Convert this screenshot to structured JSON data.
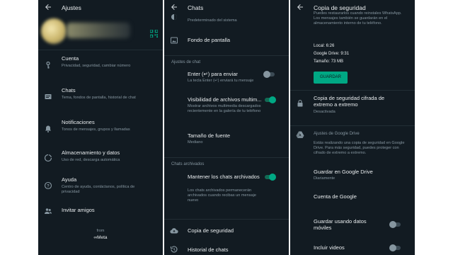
{
  "screen1": {
    "title": "Ajustes",
    "items": [
      {
        "label": "Cuenta",
        "sub": "Privacidad, seguridad, cambiar número",
        "icon": "key-icon"
      },
      {
        "label": "Chats",
        "sub": "Tema, fondos de pantalla, historial de chat",
        "icon": "chat-icon"
      },
      {
        "label": "Notificaciones",
        "sub": "Tonos de mensajes, grupos y llamadas",
        "icon": "bell-icon"
      },
      {
        "label": "Almacenamiento y datos",
        "sub": "Uso de red, descarga automática",
        "icon": "data-usage-icon"
      },
      {
        "label": "Ayuda",
        "sub": "Centro de ayuda, contáctanos, política de privacidad",
        "icon": "help-icon"
      },
      {
        "label": "Invitar amigos",
        "sub": "",
        "icon": "people-icon"
      }
    ],
    "footer_from": "from",
    "footer_brand": "∞Meta"
  },
  "screen2": {
    "title": "Chats",
    "top_partial_text": "Predeterminado del sistema",
    "wallpaper": "Fondo de pantalla",
    "section_chat": "Ajustes de chat",
    "enter_label": "Enter (↵) para enviar",
    "enter_sub": "La tecla Enter (↵) enviará tu mensaje",
    "media_label": "Visibilidad de archivos multim...",
    "media_sub": "Mostrar archivos multimedia descargados recientemente en la galería de tu teléfono",
    "font_label": "Tamaño de fuente",
    "font_sub": "Mediano",
    "section_archived": "Chats archivados",
    "archived_label": "Mantener los chats archivados",
    "archived_sub": "Los chats archivados permanecerán archivados cuando recibas un mensaje nuevo",
    "backup_label": "Copia de seguridad",
    "history_label": "Historial de chats"
  },
  "screen3": {
    "title": "Copia de seguridad",
    "intro_text": "Puedes restaurarlos cuando reinstales WhatsApp. Los mensajes también se guardarán en el almacenamiento interno de tu teléfono.",
    "local": "Local: 6:26",
    "gdrive": "Google Drive: 9:31",
    "size": "Tamaño: 73 MB",
    "save_button": "GUARDAR",
    "e2e_label": "Copia de seguridad cifrada de extremo a extremo",
    "e2e_sub": "Desactivada",
    "gd_section": "Ajustes de Google Drive",
    "gd_desc": "Estás realizando una copia de seguridad en Google Drive. Para más seguridad, puedes proteger con cifrado de extremo a extremo.",
    "save_gd_label": "Guardar en Google Drive",
    "save_gd_sub": "Diariamente",
    "account_label": "Cuenta de Google",
    "mobile_label": "Guardar usando datos móviles",
    "videos_label": "Incluir videos"
  },
  "colors": {
    "background": "#121b22",
    "accent": "#00a884",
    "text_primary": "#e9edef",
    "text_secondary": "#8696a0"
  }
}
